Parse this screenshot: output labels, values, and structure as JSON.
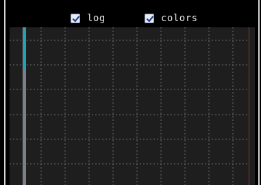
{
  "toolbar": {
    "log_checkbox": {
      "label": "log",
      "checked": true
    },
    "colors_checkbox": {
      "label": "colors",
      "checked": true
    }
  },
  "plot": {
    "grid": true,
    "left_bar_color": "#1aa6b8",
    "left_axis_color": "#7a7f88",
    "right_edge_color": "#8c3b3b",
    "grid_color": "#6e6e6e",
    "background": "#1e1e1e"
  },
  "colors": {
    "frame_border": "#d8d8d8",
    "checkbox_fill": "#e8ecf4",
    "checkmark": "#1f3f8f"
  }
}
